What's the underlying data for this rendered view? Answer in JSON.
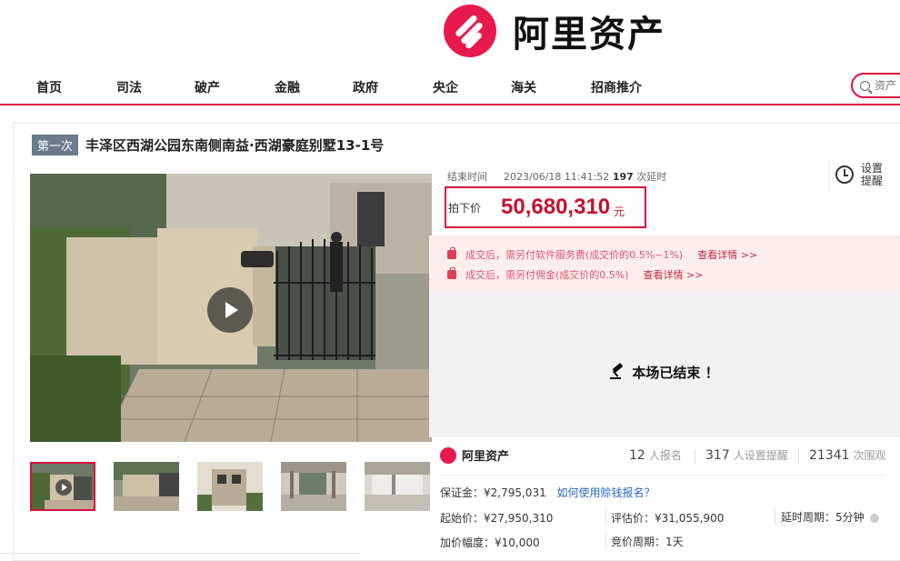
{
  "header": {
    "logo_text": "阿里资产",
    "brand_color": "#e8194b"
  },
  "nav": {
    "items": [
      "首页",
      "司法",
      "破产",
      "金融",
      "政府",
      "央企",
      "海关",
      "招商推介"
    ],
    "search_placeholder": "资产"
  },
  "item": {
    "round_tag": "第一次",
    "title": "丰泽区西湖公园东南侧南益·西湖豪庭别墅13-1号"
  },
  "gallery": {
    "main_image_label": "Villa 6",
    "thumb_count": 5
  },
  "auction": {
    "end_label": "结束时间",
    "end_time": "2023/06/18 11:41:52",
    "delay_count": "197",
    "delay_label": "次延时",
    "remind_label": "设置提醒",
    "price_label": "拍下价",
    "price_value": "50,680,310",
    "price_unit": "元",
    "price_color": "#c8102e"
  },
  "notices": [
    {
      "text": "成交后，需另付软件服务费(成交价的0.5%~1%)",
      "link": "查看详情 >>"
    },
    {
      "text": "成交后，需另付佣金(成交价的0.5%)",
      "link": "查看详情 >>"
    }
  ],
  "status": {
    "ended_text": "本场已结束 ！"
  },
  "stats": {
    "brand": "阿里资产",
    "signups": "12",
    "signups_label": "人报名",
    "reminders": "317",
    "reminders_label": "人设置提醒",
    "views": "21341",
    "views_label": "次围观"
  },
  "details": {
    "deposit": "保证金：¥2,795,031",
    "deposit_link": "如何使用赊钱报名？",
    "start_price": "起始价：¥27,950,310",
    "appraisal": "评估价：¥31,055,900",
    "delay_period": "延时周期：5分钟",
    "increment": "加价幅度：¥10,000",
    "bid_period": "竞价周期：1天"
  }
}
